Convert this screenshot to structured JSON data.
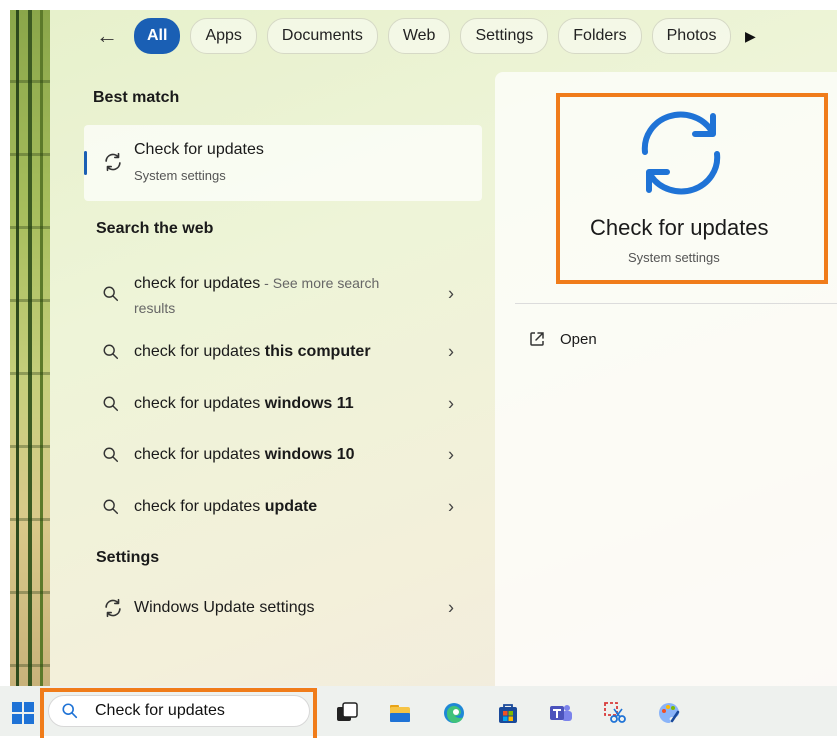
{
  "filters": {
    "chips": [
      "All",
      "Apps",
      "Documents",
      "Web",
      "Settings",
      "Folders",
      "Photos"
    ],
    "active": "All"
  },
  "best_match": {
    "header": "Best match",
    "title": "Check for updates",
    "subtitle": "System settings"
  },
  "web": {
    "header": "Search the web",
    "items": [
      {
        "prefix": "check for updates",
        "suffix": "",
        "note": " - See more search results"
      },
      {
        "prefix": "check for updates ",
        "suffix": "this computer",
        "note": ""
      },
      {
        "prefix": "check for updates ",
        "suffix": "windows 11",
        "note": ""
      },
      {
        "prefix": "check for updates ",
        "suffix": "windows 10",
        "note": ""
      },
      {
        "prefix": "check for updates ",
        "suffix": "update",
        "note": ""
      }
    ]
  },
  "settings": {
    "header": "Settings",
    "items": [
      {
        "label": "Windows Update settings"
      }
    ]
  },
  "preview": {
    "title": "Check for updates",
    "subtitle": "System settings",
    "open_label": "Open"
  },
  "taskbar": {
    "search_value": "Check for updates"
  },
  "colors": {
    "accent": "#1a5fb4",
    "highlight": "#f07c1a",
    "icon_blue": "#1f73d6"
  }
}
